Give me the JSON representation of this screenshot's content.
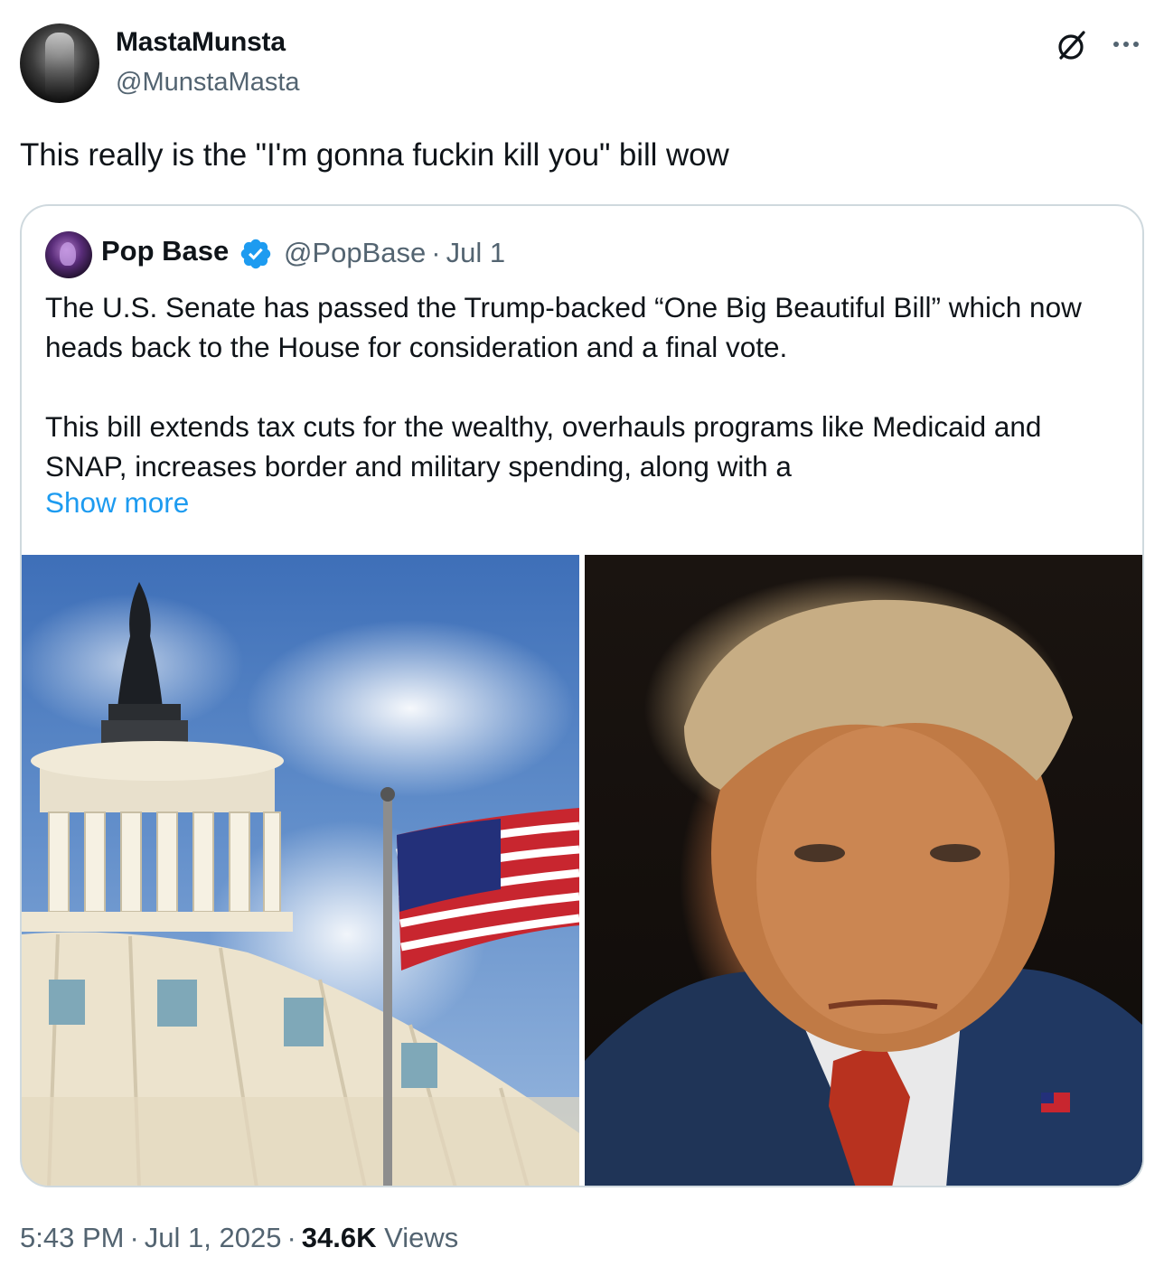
{
  "author": {
    "display_name": "MastaMunsta",
    "handle": "@MunstaMasta"
  },
  "tweet": {
    "text": "This really is the \"I'm gonna fuckin kill you\" bill wow"
  },
  "quoted_tweet": {
    "display_name": "Pop Base",
    "handle": "@PopBase",
    "separator": "·",
    "date": "Jul 1",
    "paragraph_1": "The U.S. Senate has passed the Trump-backed “One Big Beautiful Bill” which now heads back to the House for consideration and a final vote.",
    "paragraph_2": "This bill extends tax cuts for the wealthy, overhauls programs like Medicaid and SNAP, increases border and military spending, along with a",
    "show_more": "Show more"
  },
  "footer": {
    "time": "5:43 PM",
    "separator": "·",
    "date": "Jul 1, 2025",
    "views_count": "34.6K",
    "views_label": "Views"
  },
  "icons": {
    "grok": "grok-icon",
    "more": "more-icon",
    "verified": "verified-badge-icon"
  },
  "colors": {
    "link": "#1d9bf0",
    "secondary_text": "#536471",
    "border": "#cfd9de"
  }
}
